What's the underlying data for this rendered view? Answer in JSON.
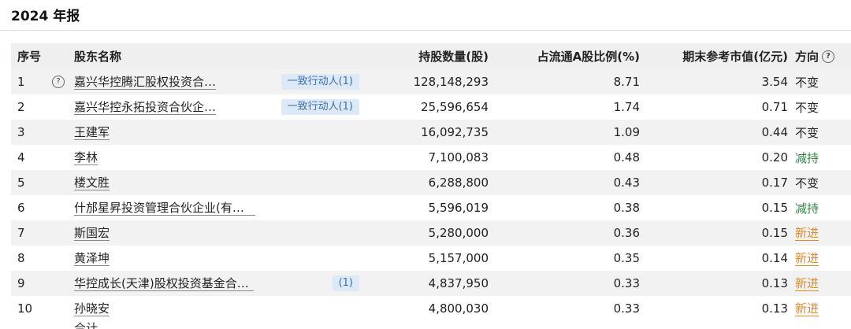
{
  "page": {
    "title": "2024 年报"
  },
  "table": {
    "headers": {
      "index": "序号",
      "name": "股东名称",
      "shares": "持股数量(股)",
      "ratio": "占流通A股比例(%)",
      "value": "期末参考市值(亿元)",
      "direction": "方向"
    },
    "rows": [
      {
        "index": "1",
        "name": "嘉兴华控腾汇股权投资合…",
        "tag": "一致行动人(1)",
        "shares": "128,148,293",
        "ratio": "8.71",
        "value": "3.54",
        "direction": "不变"
      },
      {
        "index": "2",
        "name": "嘉兴华控永拓投资合伙企…",
        "tag": "一致行动人(1)",
        "shares": "25,596,654",
        "ratio": "1.74",
        "value": "0.71",
        "direction": "不变"
      },
      {
        "index": "3",
        "name": "王建军",
        "tag": "",
        "shares": "16,092,735",
        "ratio": "1.09",
        "value": "0.44",
        "direction": "不变"
      },
      {
        "index": "4",
        "name": "李林",
        "tag": "",
        "shares": "7,100,083",
        "ratio": "0.48",
        "value": "0.20",
        "direction": "减持"
      },
      {
        "index": "5",
        "name": "楼文胜",
        "tag": "",
        "shares": "6,288,800",
        "ratio": "0.43",
        "value": "0.17",
        "direction": "不变"
      },
      {
        "index": "6",
        "name": "什邡星昇投资管理合伙企业(有限合伙)",
        "tag": "",
        "shares": "5,596,019",
        "ratio": "0.38",
        "value": "0.15",
        "direction": "减持"
      },
      {
        "index": "7",
        "name": "斯国宏",
        "tag": "",
        "shares": "5,280,000",
        "ratio": "0.36",
        "value": "0.15",
        "direction": "新进"
      },
      {
        "index": "8",
        "name": "黄泽坤",
        "tag": "",
        "shares": "5,157,000",
        "ratio": "0.35",
        "value": "0.14",
        "direction": "新进"
      },
      {
        "index": "9",
        "name": "华控成长(天津)股权投资基金合伙企…",
        "tag": "(1)",
        "shares": "4,837,950",
        "ratio": "0.33",
        "value": "0.13",
        "direction": "新进"
      },
      {
        "index": "10",
        "name": "孙晓安",
        "tag": "",
        "shares": "4,800,030",
        "ratio": "0.33",
        "value": "0.13",
        "direction": "新进"
      }
    ],
    "footer_partial": "合计"
  },
  "colors": {
    "tag_bg": "#dde9f7",
    "tag_text": "#3a6fb0",
    "decrease": "#2b8a3e",
    "new": "#e8891c"
  }
}
